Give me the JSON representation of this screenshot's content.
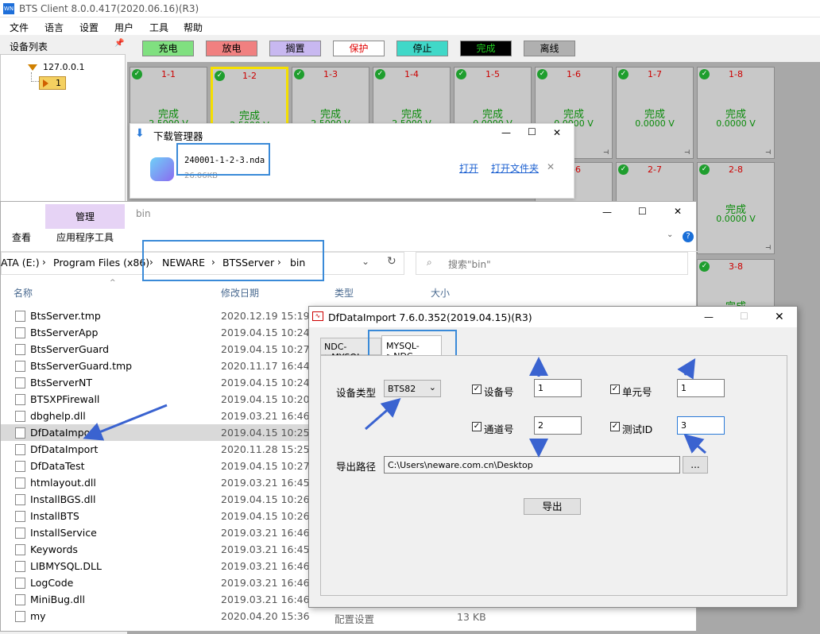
{
  "app": {
    "title": "BTS Client 8.0.0.417(2020.06.16)(R3)",
    "icon": "WN",
    "menus": [
      "文件",
      "语言",
      "设置",
      "用户",
      "工具",
      "帮助"
    ]
  },
  "device_list": {
    "header": "设备列表",
    "ip": "127.0.0.1",
    "unit": "1"
  },
  "legend": [
    {
      "label": "充电",
      "bg": "#80e080",
      "fg": "#000"
    },
    {
      "label": "放电",
      "bg": "#f08080",
      "fg": "#000"
    },
    {
      "label": "搁置",
      "bg": "#c8b8f0",
      "fg": "#000"
    },
    {
      "label": "保护",
      "bg": "#ffffff",
      "fg": "#e00000"
    },
    {
      "label": "停止",
      "bg": "#40d8c8",
      "fg": "#000"
    },
    {
      "label": "完成",
      "bg": "#000000",
      "fg": "#20d020"
    },
    {
      "label": "离线",
      "bg": "#b0b0b0",
      "fg": "#000"
    }
  ],
  "channels": [
    {
      "id": "1-1",
      "state": "完成",
      "voltage": "2.5000 V"
    },
    {
      "id": "1-2",
      "state": "完成",
      "voltage": "2.5000 V",
      "selected": true
    },
    {
      "id": "1-3",
      "state": "完成",
      "voltage": "2.5000 V"
    },
    {
      "id": "1-4",
      "state": "完成",
      "voltage": "2.5000 V"
    },
    {
      "id": "1-5",
      "state": "完成",
      "voltage": "0.0000 V"
    },
    {
      "id": "1-6",
      "state": "完成",
      "voltage": "0.0000 V"
    },
    {
      "id": "1-7",
      "state": "完成",
      "voltage": "0.0000 V"
    },
    {
      "id": "1-8",
      "state": "完成",
      "voltage": "0.0000 V"
    },
    {
      "id": "2-6",
      "state": "",
      "voltage": ""
    },
    {
      "id": "2-7",
      "state": "",
      "voltage": ""
    },
    {
      "id": "2-8",
      "state": "完成",
      "voltage": "0.0000 V"
    },
    {
      "id": "3-8",
      "state": "完成",
      "voltage": ""
    }
  ],
  "download_manager": {
    "title": "下载管理器",
    "filename": "240001-1-2-3.nda",
    "size": "26.06KB",
    "open": "打开",
    "open_folder": "打开文件夹",
    "close": "✕"
  },
  "explorer": {
    "title": "bin",
    "ribbon_manage": "管理",
    "ribbon_view": "查看",
    "ribbon_apptools": "应用程序工具",
    "path": [
      "ATA (E:)",
      "Program Files (x86)",
      "NEWARE",
      "BTSServer",
      "bin"
    ],
    "search_placeholder": "搜索\"bin\"",
    "col_name": "名称",
    "col_date": "修改日期",
    "col_type": "类型",
    "col_size": "大小",
    "files": [
      {
        "name": "BtsServer.tmp",
        "date": "2020.12.19 15:19"
      },
      {
        "name": "BtsServerApp",
        "date": "2019.04.15 10:24"
      },
      {
        "name": "BtsServerGuard",
        "date": "2019.04.15 10:27"
      },
      {
        "name": "BtsServerGuard.tmp",
        "date": "2020.11.17 16:44"
      },
      {
        "name": "BtsServerNT",
        "date": "2019.04.15 10:24"
      },
      {
        "name": "BTSXPFirewall",
        "date": "2019.04.15 10:20"
      },
      {
        "name": "dbghelp.dll",
        "date": "2019.03.21 16:46"
      },
      {
        "name": "DfDataImport",
        "date": "2019.04.15 10:25",
        "selected": true
      },
      {
        "name": "DfDataImport",
        "date": "2020.11.28 15:25"
      },
      {
        "name": "DfDataTest",
        "date": "2019.04.15 10:27"
      },
      {
        "name": "htmlayout.dll",
        "date": "2019.03.21 16:45"
      },
      {
        "name": "InstallBGS.dll",
        "date": "2019.04.15 10:26"
      },
      {
        "name": "InstallBTS",
        "date": "2019.04.15 10:26"
      },
      {
        "name": "InstallService",
        "date": "2019.03.21 16:46"
      },
      {
        "name": "Keywords",
        "date": "2019.03.21 16:45"
      },
      {
        "name": "LIBMYSQL.DLL",
        "date": "2019.03.21 16:46"
      },
      {
        "name": "LogCode",
        "date": "2019.03.21 16:46"
      },
      {
        "name": "MiniBug.dll",
        "date": "2019.03.21 16:46"
      },
      {
        "name": "my",
        "date": "2020.04.20 15:36",
        "type": "配置设置",
        "size": "13 KB"
      }
    ]
  },
  "dialog": {
    "title": "DfDataImport 7.6.0.352(2019.04.15)(R3)",
    "tabs": [
      "NDC->MYSQL",
      "MYSQL->NDC"
    ],
    "device_type_label": "设备类型",
    "device_type_value": "BTS82",
    "device_no_label": "设备号",
    "device_no_value": "1",
    "unit_no_label": "单元号",
    "unit_no_value": "1",
    "channel_no_label": "通道号",
    "channel_no_value": "2",
    "test_id_label": "测试ID",
    "test_id_value": "3",
    "export_path_label": "导出路径",
    "export_path_value": "C:\\Users\\neware.com.cn\\Desktop",
    "browse": "...",
    "export_button": "导出"
  }
}
